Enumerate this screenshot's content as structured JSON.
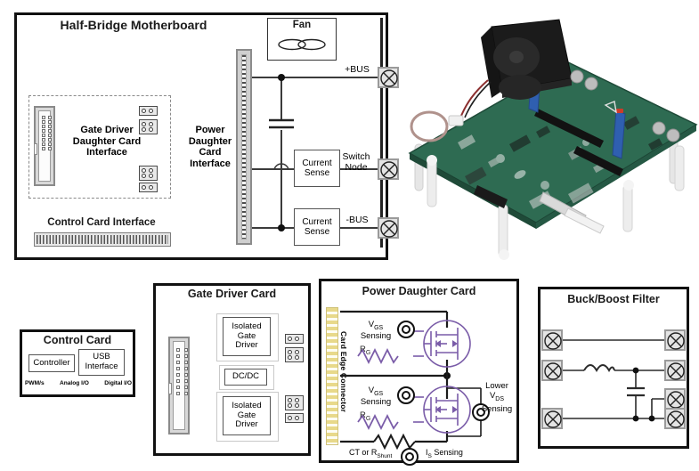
{
  "motherboard": {
    "title": "Half-Bridge Motherboard",
    "gate_driver_interface_label": "Gate Driver\nDaughter Card\nInterface",
    "gate_driver_interface_lines": [
      "Gate Driver",
      "Daughter Card",
      "Interface"
    ],
    "control_card_interface_label": "Control Card Interface",
    "power_daughter_interface_lines": [
      "Power",
      "Daughter",
      "Card",
      "Interface"
    ],
    "fan_label": "Fan",
    "current_sense_lines": [
      "Current",
      "Sense"
    ],
    "terminals": [
      {
        "label": "+BUS"
      },
      {
        "label": "Switch\nNode",
        "lines": [
          "Switch",
          "Node"
        ]
      },
      {
        "label": "-BUS"
      }
    ]
  },
  "control_card": {
    "title": "Control Card",
    "controller_label": "Controller",
    "usb_lines": [
      "USB",
      "Interface"
    ],
    "io_labels": [
      "PWM/s",
      "Analog I/O",
      "Digital I/O"
    ]
  },
  "gate_driver_card": {
    "title": "Gate Driver Card",
    "driver_lines": [
      "Isolated",
      "Gate",
      "Driver"
    ],
    "dcdc_label": "DC/DC"
  },
  "power_daughter_card": {
    "title": "Power Daughter Card",
    "card_edge_label": "Card Edge Connector",
    "vgs_upper_lines": [
      "V",
      "GS",
      "Sensing"
    ],
    "vgs_label": "V",
    "vgs_sub": "GS",
    "sensing_label": "Sensing",
    "rg_label": "R",
    "rg_sub": "G",
    "lower_vds_lines": [
      "Lower",
      "V",
      "DS",
      "Sensing"
    ],
    "lower_label": "Lower",
    "vds_label": "V",
    "vds_sub": "DS",
    "shunt_label": "CT or R",
    "shunt_sub": "Shunt",
    "is_label": "I",
    "is_sub": "S",
    "is_sensing_label": "Sensing"
  },
  "buck_boost_filter": {
    "title": "Buck/Boost Filter"
  },
  "photo": {
    "alt_name": "half-bridge-motherboard-pcb-photo",
    "board_color": "#2e6b52",
    "fan_color": "#1b1b1b",
    "retainer_color": "#2f5fb0",
    "standoff_color": "#ededed"
  },
  "colors": {
    "line": "#222222",
    "accent_purple": "#7a5ca8",
    "edge_gold": "#e8d98a"
  }
}
